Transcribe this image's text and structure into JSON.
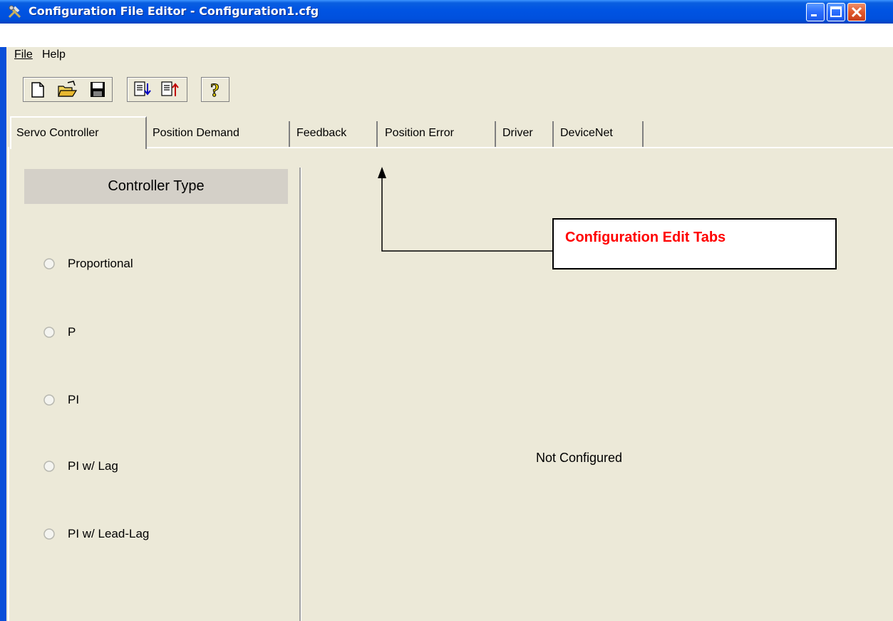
{
  "window": {
    "title": "Configuration File Editor - Configuration1.cfg"
  },
  "menubar": {
    "items": [
      {
        "label": "File"
      },
      {
        "label": "Help"
      }
    ]
  },
  "toolbar": {
    "buttons": [
      "new-document-icon",
      "open-folder-icon",
      "save-icon",
      "import-icon",
      "export-icon",
      "help-icon"
    ]
  },
  "tabs": [
    {
      "label": "Servo Controller",
      "active": true
    },
    {
      "label": "Position Demand"
    },
    {
      "label": "Feedback"
    },
    {
      "label": "Position Error"
    },
    {
      "label": "Driver"
    },
    {
      "label": "DeviceNet"
    }
  ],
  "controller_type": {
    "header": "Controller Type",
    "options": [
      {
        "label": "Proportional",
        "selected": false
      },
      {
        "label": "P",
        "selected": false
      },
      {
        "label": "PI",
        "selected": false
      },
      {
        "label": "PI w/ Lag",
        "selected": false
      },
      {
        "label": "PI w/ Lead-Lag",
        "selected": false
      }
    ]
  },
  "main": {
    "status": "Not Configured"
  },
  "annotation": {
    "label": "Configuration Edit Tabs",
    "color": "#ff0000"
  },
  "colors": {
    "title_bar": "#0054e3",
    "window_bg": "#ece9d8",
    "header_bg": "#d4d0c8"
  }
}
